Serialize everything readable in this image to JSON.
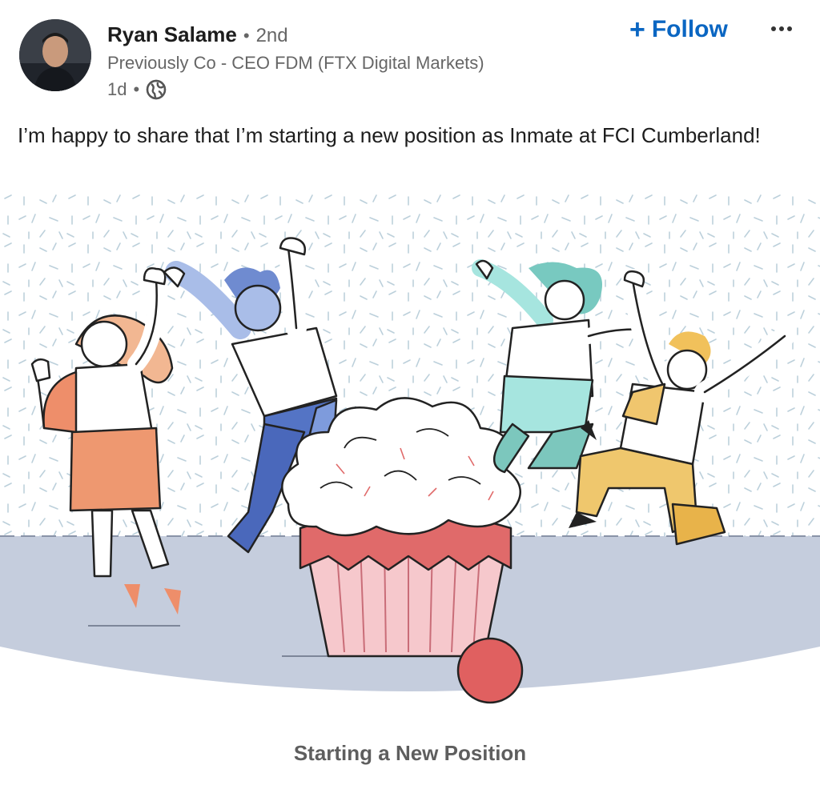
{
  "author": {
    "name": "Ryan Salame",
    "separator": "•",
    "degree": "2nd",
    "headline": "Previously Co - CEO FDM (FTX Digital Markets)",
    "time": "1d",
    "meta_separator": "•",
    "visibility_icon": "globe-icon"
  },
  "actions": {
    "follow_plus": "+",
    "follow_label": "Follow",
    "more_icon": "ellipsis-icon"
  },
  "post": {
    "text": "I’m happy to share that I’m starting a new position as Inmate at FCI Cumberland!"
  },
  "card": {
    "caption": "Starting a New Position"
  },
  "colors": {
    "accent": "#0a66c2",
    "ground": "#c5cddd",
    "frosting_base": "#e06a6a",
    "cup": "#f6c8cc"
  }
}
